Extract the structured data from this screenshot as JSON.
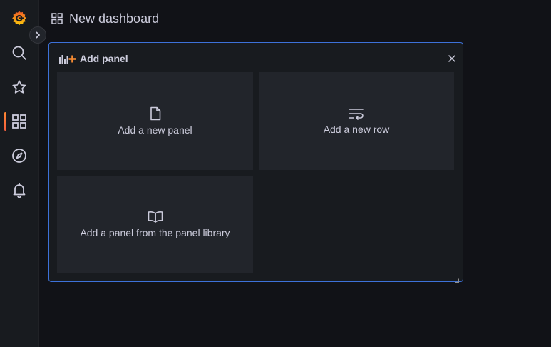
{
  "header": {
    "title": "New dashboard",
    "icon": "dashboard-grid-icon"
  },
  "sidebar": {
    "items": [
      {
        "name": "grafana-logo",
        "icon": "grafana-logo"
      },
      {
        "name": "search",
        "icon": "search-icon"
      },
      {
        "name": "starred",
        "icon": "star-icon"
      },
      {
        "name": "dashboards",
        "icon": "apps-icon",
        "active": true
      },
      {
        "name": "explore",
        "icon": "compass-icon"
      },
      {
        "name": "alerting",
        "icon": "bell-icon"
      }
    ],
    "expand_icon": "chevron-right-icon"
  },
  "add_panel": {
    "title": "Add panel",
    "options": [
      {
        "label": "Add a new panel",
        "icon": "file-icon"
      },
      {
        "label": "Add a new row",
        "icon": "wrap-text-icon"
      },
      {
        "label": "Add a panel from the panel library",
        "icon": "book-open-icon"
      }
    ]
  },
  "colors": {
    "background": "#111217",
    "sidebar": "#181b1f",
    "card": "#22252b",
    "accent_border": "#3d71d9",
    "brand_orange": "#f58a32"
  }
}
